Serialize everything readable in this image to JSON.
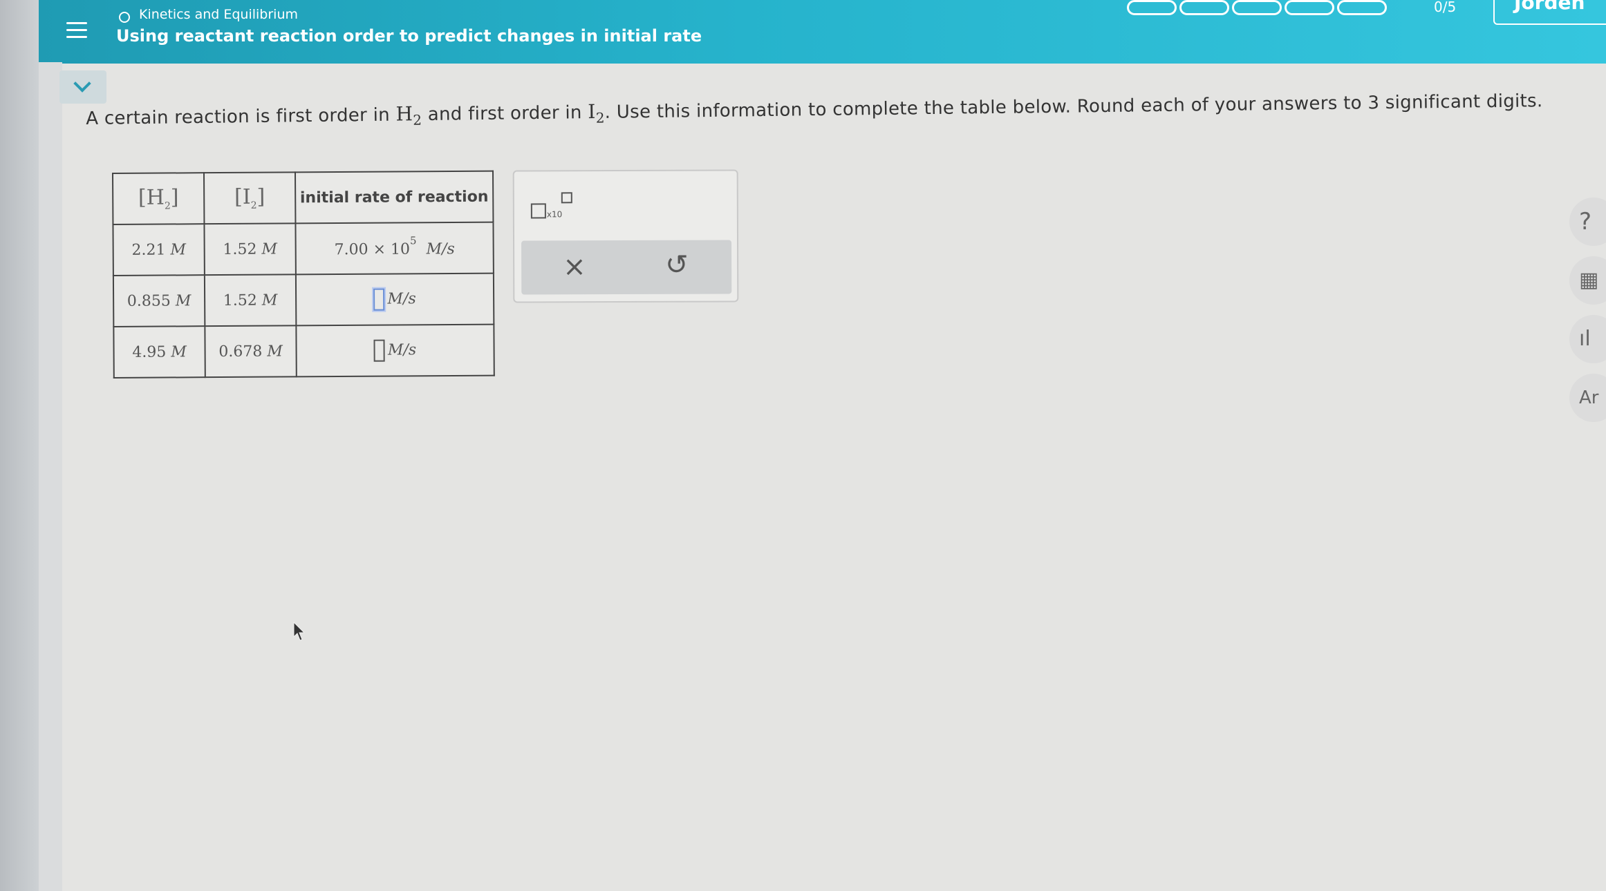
{
  "header": {
    "topic": "Kinetics and Equilibrium",
    "title": "Using reactant reaction order to predict changes in initial rate",
    "progress": {
      "segments": 5,
      "completed": 0,
      "label": "0/5"
    },
    "user_label": "Jorden"
  },
  "question": {
    "part1": "A certain reaction is first order in ",
    "chem1": "H",
    "sub1": "2",
    "part2": " and first order in ",
    "chem2": "I",
    "sub2": "2",
    "part3": ". Use this information to complete the table below. Round each of your answers to 3 significant digits."
  },
  "table": {
    "headers": {
      "h2": "H",
      "h2_sub": "2",
      "i2": "I",
      "i2_sub": "2",
      "rate": "initial rate of reaction"
    },
    "rows": [
      {
        "h2": "2.21",
        "i2": "1.52",
        "rate_mantissa": "7.00",
        "rate_times": "×",
        "rate_base": "10",
        "rate_exp": "5",
        "rate_unit": "M/s"
      },
      {
        "h2": "0.855",
        "i2": "1.52",
        "rate_unit": "M/s"
      },
      {
        "h2": "4.95",
        "i2": "0.678",
        "rate_unit": "M/s"
      }
    ],
    "conc_unit": "M"
  },
  "tools": {
    "x10_label": "x10",
    "clear_symbol": "×",
    "undo_symbol": "↺"
  },
  "side_tools": {
    "help": "?",
    "calc": "▦",
    "chart": "ıl",
    "periodic": "Ar"
  },
  "colors": {
    "header_start": "#1f9bb3",
    "header_end": "#35c6de",
    "accent": "#2a9bb3"
  }
}
